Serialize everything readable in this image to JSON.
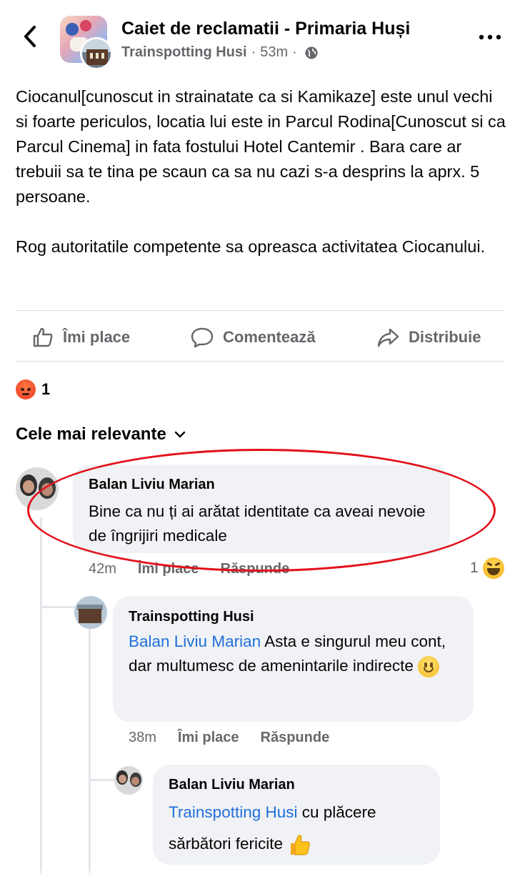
{
  "header": {
    "title": "Caiet de reclamatii - Primaria Huși",
    "author": "Trainspotting Husi",
    "time": "53m"
  },
  "post": {
    "text": "Ciocanul[cunoscut in strainatate ca si Kamikaze] este unul vechi si foarte periculos, locatia lui este in Parcul Rodina[Cunoscut si ca Parcul Cinema] in fata fostului Hotel Cantemir . Bara care ar trebuii sa te tina pe scaun ca sa nu cazi s-a desprins la aprx. 5 persoane.\n\nRog autoritatile competente sa opreasca activitatea Ciocanului."
  },
  "actions": {
    "like": "Îmi place",
    "comment": "Comentează",
    "share": "Distribuie"
  },
  "reactions": {
    "count": "1",
    "type": "angry-icon"
  },
  "sort": {
    "label": "Cele mai relevante"
  },
  "comments": [
    {
      "name": "Balan Liviu Marian",
      "text": "Bine ca nu  ți ai arătat identitate ca aveai nevoie de îngrijiri medicale",
      "time": "42m",
      "like": "Îmi place",
      "reply": "Răspunde",
      "reaction_count": "1"
    },
    {
      "name": "Trainspotting Husi",
      "mention": "Balan Liviu Marian",
      "text": " Asta e singurul meu cont, dar multumesc de amenintarile indirecte ",
      "time": "38m",
      "like": "Îmi place",
      "reply": "Răspunde"
    },
    {
      "name": "Balan Liviu Marian",
      "mention": "Trainspotting Husi",
      "text_line1": "  cu plăcere",
      "text_line2": "sărbători fericite "
    }
  ],
  "colors": {
    "accent_link": "#216fdb",
    "muted": "#65676b",
    "bubble": "#f0f2f5",
    "highlight": "#e3101a"
  }
}
